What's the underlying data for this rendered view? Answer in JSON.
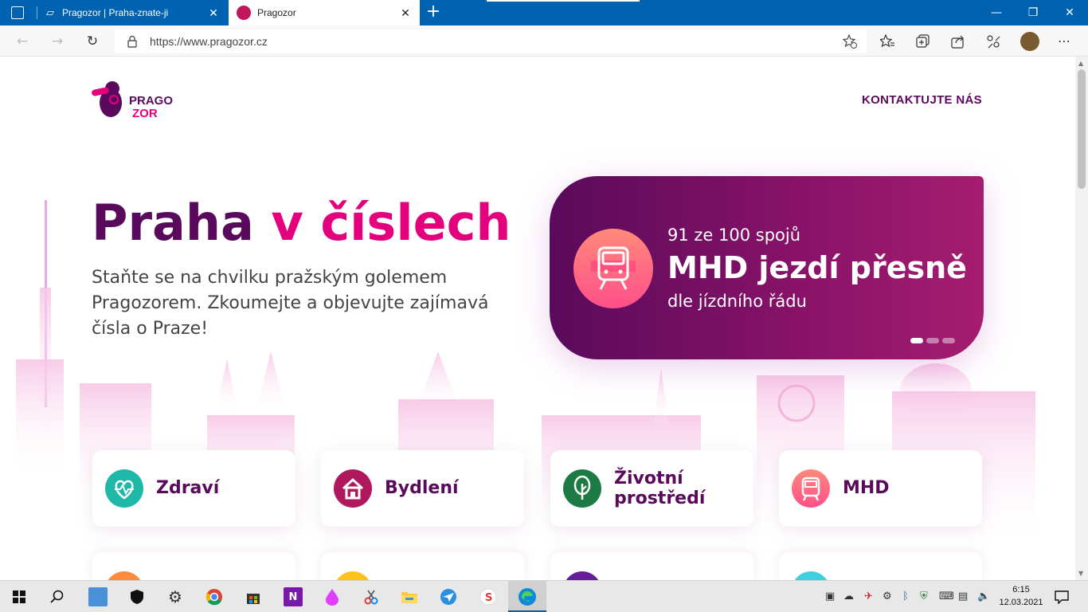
{
  "browser": {
    "tabs": [
      {
        "title": "Pragozor | Praha-znate-ji",
        "close": "✕"
      },
      {
        "title": "Pragozor",
        "close": "✕"
      }
    ],
    "new_tab": "+",
    "window_controls": {
      "minimize": "—",
      "maximize": "❐",
      "close": "✕"
    },
    "url": "https://www.pragozor.cz",
    "nav": {
      "back": "←",
      "forward": "→",
      "refresh": "↻"
    }
  },
  "site": {
    "logo": {
      "line1": "PRAGO",
      "line2": "ZOR"
    },
    "contact_label": "KONTAKTUJTE NÁS",
    "hero": {
      "title_part1": "Praha ",
      "title_part2": "v číslech",
      "subtitle": "Staňte se na chvilku pražským golemem Pragozorem. Zkoumejte a objevujte zajímavá čísla o Praze!"
    },
    "banner": {
      "line1": "91 ze 100 spojů",
      "line2": "MHD jezdí přesně",
      "line3": "dle jízdního řádu",
      "dots": 3,
      "active_dot": 0,
      "colors": {
        "start": "#5a0a5c",
        "end": "#a51d6f"
      }
    },
    "categories": [
      {
        "label": "Zdraví",
        "icon": "heart-pulse-icon",
        "color": "#1fb8a8"
      },
      {
        "label": "Bydlení",
        "icon": "house-icon",
        "color": "#b0185e"
      },
      {
        "label": "Životní prostředí",
        "icon": "tree-icon",
        "color": "#1e7a45"
      },
      {
        "label": "MHD",
        "icon": "tram-icon",
        "color": "#ff6b8a"
      }
    ],
    "categories_row2_colors": [
      "#ff8a3d",
      "#ffc21a",
      "#6a1b9a",
      "#3fd0e0"
    ]
  },
  "taskbar": {
    "clock_time": "6:15",
    "clock_date": "12.03.2021"
  }
}
